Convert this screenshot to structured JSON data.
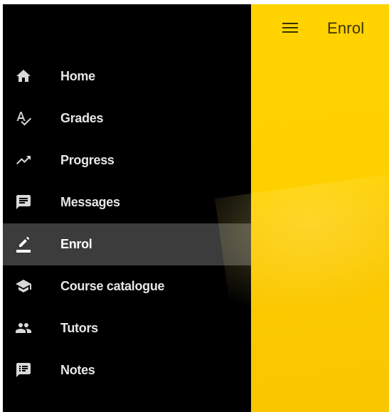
{
  "header": {
    "title": "Enrol",
    "menu_icon": "hamburger-menu-icon"
  },
  "sidebar": {
    "items": [
      {
        "label": "Home",
        "icon": "home-icon"
      },
      {
        "label": "Grades",
        "icon": "spellcheck-icon"
      },
      {
        "label": "Progress",
        "icon": "trending-up-icon"
      },
      {
        "label": "Messages",
        "icon": "message-icon"
      },
      {
        "label": "Enrol",
        "icon": "pencil-icon",
        "active": true
      },
      {
        "label": "Course catalogue",
        "icon": "school-icon"
      },
      {
        "label": "Tutors",
        "icon": "people-icon"
      },
      {
        "label": "Notes",
        "icon": "notes-icon"
      }
    ]
  },
  "colors": {
    "sidebar_bg": "#000000",
    "active_bg": "#3c3c3c",
    "accent": "#ffd200",
    "icon": "#d9d9d9"
  }
}
